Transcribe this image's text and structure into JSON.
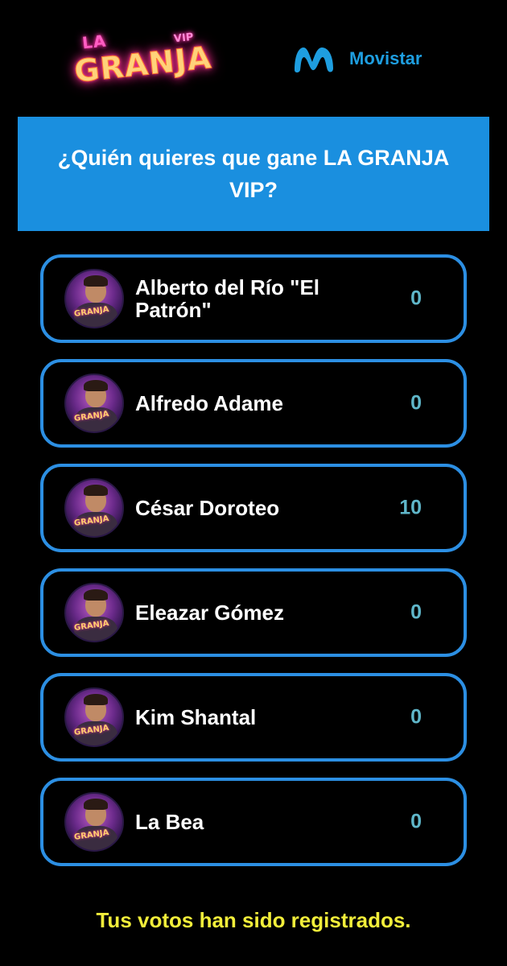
{
  "header": {
    "granja_logo": {
      "line1": "LA",
      "line2": "GRANJA",
      "badge": "VIP"
    },
    "sponsor_logo": {
      "icon": "movistar-m-icon",
      "text": "Movistar",
      "color": "#1e9ee0"
    }
  },
  "question": {
    "text": "¿Quién quieres que gane LA GRANJA VIP?",
    "background": "#1a8fdf"
  },
  "contestants": [
    {
      "name": "Alberto del Río \"El Patrón\"",
      "votes": "0"
    },
    {
      "name": "Alfredo Adame",
      "votes": "0"
    },
    {
      "name": "César Doroteo",
      "votes": "10"
    },
    {
      "name": "Eleazar Gómez",
      "votes": "0"
    },
    {
      "name": "Kim Shantal",
      "votes": "0"
    },
    {
      "name": "La Bea",
      "votes": "0"
    }
  ],
  "avatar_badge": "GRANJA",
  "footer": {
    "message": "Tus votos han sido registrados.",
    "color": "#f2ee3a"
  },
  "colors": {
    "card_border": "#2c8fe3",
    "vote_count": "#5fb6c9",
    "background": "#000000"
  }
}
